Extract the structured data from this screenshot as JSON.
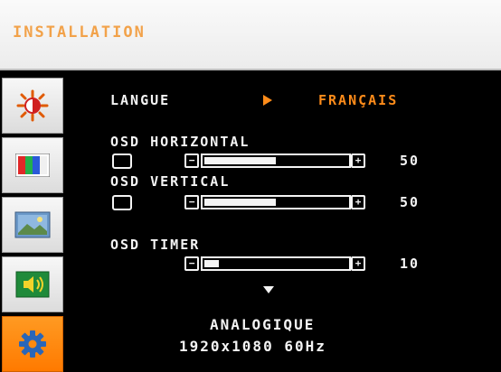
{
  "header": {
    "title": "INSTALLATION"
  },
  "sidebar": {
    "items": [
      {
        "id": "brightness",
        "icon": "sun-icon",
        "active": false
      },
      {
        "id": "color",
        "icon": "color-bars-icon",
        "active": false
      },
      {
        "id": "image",
        "icon": "image-icon",
        "active": false
      },
      {
        "id": "audio",
        "icon": "speaker-icon",
        "active": false
      },
      {
        "id": "setup",
        "icon": "gear-icon",
        "active": true
      }
    ]
  },
  "menu": {
    "language": {
      "label": "LANGUE",
      "value": "FRANÇAIS"
    },
    "osd_horizontal": {
      "label": "OSD HORIZONTAL",
      "value": "50",
      "percent": 50
    },
    "osd_vertical": {
      "label": "OSD VERTICAL",
      "value": "50",
      "percent": 50
    },
    "osd_timer": {
      "label": "OSD TIMER",
      "value": "10",
      "percent": 10
    },
    "minus_symbol": "−",
    "plus_symbol": "+"
  },
  "status": {
    "input": "ANALOGIQUE",
    "resolution": "1920x1080 60Hz"
  },
  "colors": {
    "accent": "#ff8c1a",
    "text": "#f4f4f4",
    "background": "#000000"
  }
}
